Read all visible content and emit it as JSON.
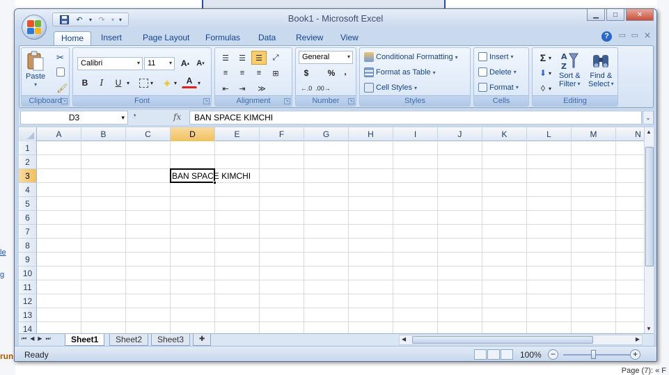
{
  "window": {
    "title": "Book1 - Microsoft Excel"
  },
  "tabs": [
    "Home",
    "Insert",
    "Page Layout",
    "Formulas",
    "Data",
    "Review",
    "View"
  ],
  "ribbon": {
    "clipboard": {
      "label": "Clipboard",
      "paste": "Paste"
    },
    "font": {
      "label": "Font",
      "name": "Calibri",
      "size": "11"
    },
    "alignment": {
      "label": "Alignment"
    },
    "number": {
      "label": "Number",
      "format": "General",
      "currency": "$",
      "percent": "%",
      "comma": ","
    },
    "styles": {
      "label": "Styles",
      "conditional": "Conditional Formatting",
      "format_table": "Format as Table",
      "cell_styles": "Cell Styles"
    },
    "cells": {
      "label": "Cells",
      "insert": "Insert",
      "delete": "Delete",
      "format": "Format"
    },
    "editing": {
      "label": "Editing",
      "sort_1": "Sort &",
      "sort_2": "Filter",
      "find_1": "Find &",
      "find_2": "Select"
    }
  },
  "formula_bar": {
    "name_box": "D3",
    "fx": "fx",
    "value": "BAN SPACE KIMCHI"
  },
  "sheet": {
    "columns": [
      "A",
      "B",
      "C",
      "D",
      "E",
      "F",
      "G",
      "H",
      "I",
      "J",
      "K",
      "L",
      "M",
      "N"
    ],
    "rows": [
      "1",
      "2",
      "3",
      "4",
      "5",
      "6",
      "7",
      "8",
      "9",
      "10",
      "11",
      "12",
      "13",
      "14"
    ],
    "selected_col": "D",
    "selected_row": "3",
    "cell_d3": "BAN SPACE KIMCHI"
  },
  "sheet_tabs": [
    "Sheet1",
    "Sheet2",
    "Sheet3"
  ],
  "status": {
    "text": "Ready",
    "zoom": "100%"
  },
  "background": {
    "left_1": "le",
    "left_2": "g",
    "left_3": "run",
    "bottom_right": "Page (7): « F"
  }
}
